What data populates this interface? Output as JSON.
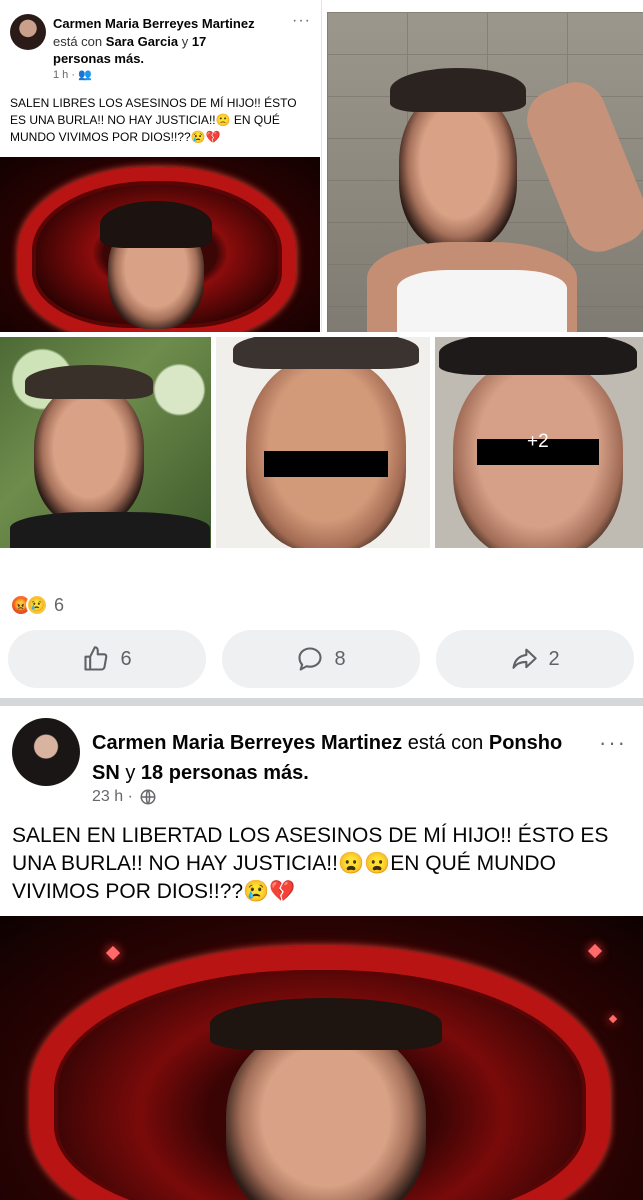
{
  "collage": {
    "embedded_post": {
      "author": "Carmen Maria Berreyes Martinez",
      "with_prefix": "está con",
      "tagged": "Sara Garcia",
      "and": "y",
      "others": "17 personas más.",
      "time": "1 h ·",
      "text": "SALEN LIBRES LOS ASESINOS DE MÍ HIJO!! ÉSTO ES UNA BURLA!! NO HAY JUSTICIA!!🙁 EN QUÉ MUNDO VIVIMOS POR DIOS!!??😢💔"
    },
    "overflow_count": "+2"
  },
  "reactions": {
    "count": "6",
    "icons": [
      "angry-face",
      "crying-face"
    ]
  },
  "actions": {
    "like": {
      "icon": "thumbs-up-icon",
      "count": "6"
    },
    "comment": {
      "icon": "comment-icon",
      "count": "8"
    },
    "share": {
      "icon": "share-icon",
      "count": "2"
    }
  },
  "post": {
    "author": "Carmen Maria Berreyes Martinez",
    "with_prefix": "está con",
    "tagged": "Ponsho SN",
    "and": "y",
    "others": "18 personas más.",
    "time": "23 h ·",
    "privacy_icon": "globe-icon",
    "text": "SALEN EN LIBERTAD LOS ASESINOS DE MÍ HIJO!! ÉSTO ES UNA BURLA!! NO HAY JUSTICIA!!😦😦EN QUÉ MUNDO VIVIMOS POR DIOS!!??😢💔"
  }
}
